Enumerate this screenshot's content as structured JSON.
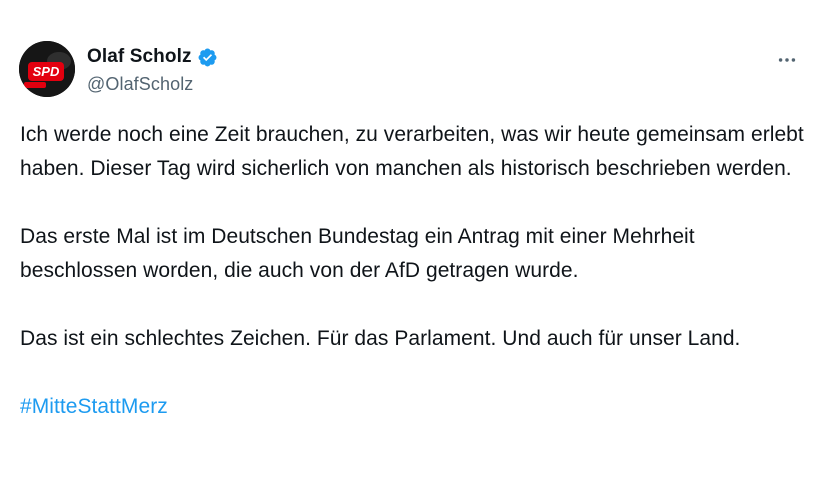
{
  "author": {
    "display_name": "Olaf Scholz",
    "handle": "@OlafScholz",
    "verified": true,
    "avatar_icon": "spd-logo-avatar",
    "verified_icon": "verified-badge-icon",
    "verified_color": "#1d9bf0"
  },
  "menu": {
    "icon": "more-horizontal-icon"
  },
  "tweet": {
    "paragraphs": [
      "Ich werde noch eine Zeit brauchen, zu verarbeiten, was wir heute gemeinsam erlebt haben. Dieser Tag wird sicherlich von manchen als historisch beschrieben werden.",
      "Das erste Mal ist im Deutschen Bundestag ein Antrag mit einer Mehrheit beschlossen worden, die auch von der AfD getragen wurde.",
      "Das ist ein schlechtes Zeichen. Für das Parlament. Und auch für unser Land."
    ],
    "hashtag": "#MitteStattMerz",
    "link_color": "#1d9bf0"
  }
}
